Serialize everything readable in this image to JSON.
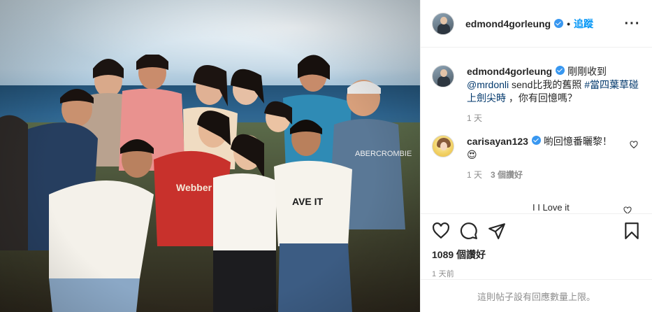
{
  "post": {
    "username": "edmond4gorleung",
    "follow_label": "追蹤",
    "separator": "•",
    "more_icon": "more-horizontal-icon"
  },
  "caption": {
    "username": "edmond4gorleung",
    "text_start": "剛剛收到",
    "mention": "@mrdonli",
    "text_mid": " send比我的舊照 ",
    "hashtag": "#當四葉草碰上劍尖時",
    "text_end": " ，你有回憶嗎？",
    "time": "1 天"
  },
  "comments": [
    {
      "username": "carisayan123",
      "text": "喲回憶番曬黎！",
      "emoji": "😍",
      "time": "1 天",
      "likes": "3 個讚好"
    }
  ],
  "partial_comment": "I I Love it",
  "actions": {
    "like_icon": "heart-icon",
    "comment_icon": "comment-icon",
    "share_icon": "paper-plane-icon",
    "save_icon": "bookmark-icon",
    "likes_count": "1089 個讚好",
    "time_ago": "1 天前"
  },
  "footer": {
    "notice": "這則帖子設有回應數量上限。"
  },
  "colors": {
    "accent": "#0095f6",
    "verified": "#3897f0",
    "muted": "#8e8e8e"
  }
}
